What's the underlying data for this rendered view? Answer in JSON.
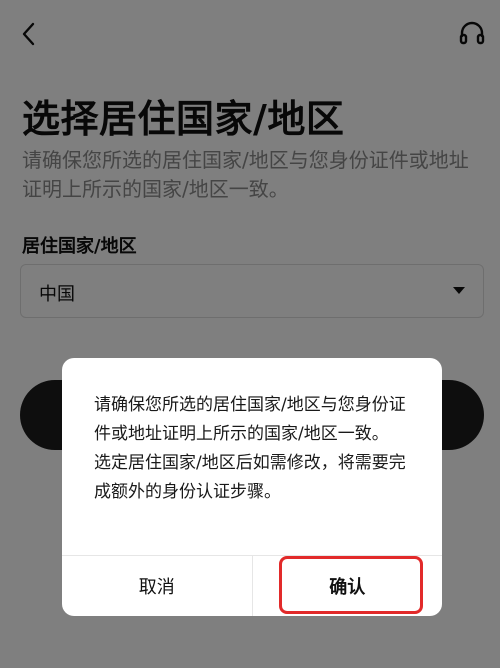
{
  "header": {
    "back_icon": "chevron-left-icon",
    "support_icon": "headset-icon"
  },
  "main": {
    "title": "选择居住国家/地区",
    "subtitle": "请确保您所选的居住国家/地区与您身份证件或地址证明上所示的国家/地区一致。",
    "field_label": "居住国家/地区",
    "selected_country": "中国",
    "dropdown_icon": "caret-down-icon"
  },
  "dialog": {
    "message_line1": "请确保您所选的居住国家/地区与您身份证件或地址证明上所示的国家/地区一致。",
    "message_line2": "选定居住国家/地区后如需修改，将需要完成额外的身份认证步骤。",
    "cancel_label": "取消",
    "confirm_label": "确认"
  },
  "colors": {
    "primary_dark": "#1c1c1c",
    "overlay": "rgba(0,0,0,0.5)",
    "highlight": "#e22a2a",
    "subtitle_gray": "#8a8a8a"
  }
}
